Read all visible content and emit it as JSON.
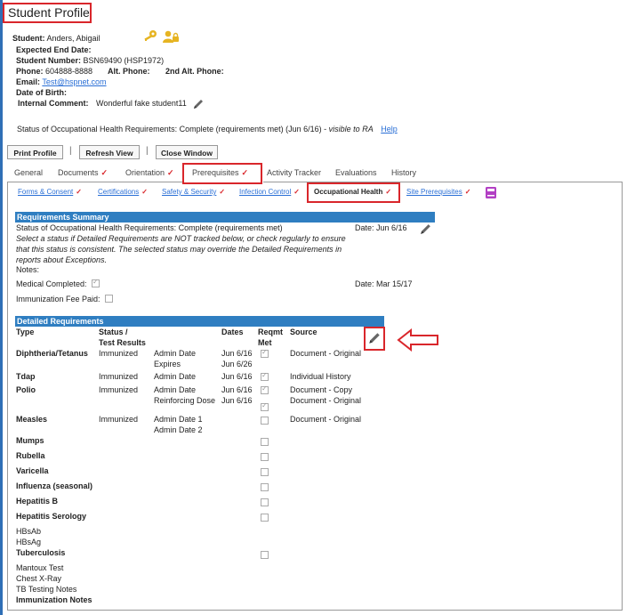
{
  "header": {
    "title": "Student Profile",
    "student_label": "Student:",
    "student_name": "Anders, Abigail",
    "expected_end_date_label": "Expected End Date:",
    "student_number_label": "Student Number:",
    "student_number": "BSN69490  (HSP1972)",
    "phone_label": "Phone:",
    "phone": "604888-8888",
    "alt_phone_label": "Alt. Phone:",
    "alt_phone2_label": "2nd Alt. Phone:",
    "email_label": "Email:",
    "email": "Test@hspnet.com",
    "dob_label": "Date of Birth:",
    "internal_comment_label": "Internal Comment:",
    "internal_comment": "Wonderful fake student11",
    "status_text": "Status of Occupational Health Requirements: Complete (requirements met) (Jun 6/16) - ",
    "status_visible": "visible to RA",
    "help": "Help"
  },
  "toolbar": {
    "print_profile": "Print Profile",
    "refresh_view": "Refresh View",
    "close_window": "Close Window",
    "separator": "|"
  },
  "tabs": [
    {
      "label": "General"
    },
    {
      "label": "Documents"
    },
    {
      "label": "Orientation"
    },
    {
      "label": "Prerequisites"
    },
    {
      "label": "Activity Tracker"
    },
    {
      "label": "Evaluations"
    },
    {
      "label": "History"
    }
  ],
  "check_mark": "✓",
  "subtabs": [
    {
      "label": "Forms & Consent"
    },
    {
      "label": "Certifications"
    },
    {
      "label": "Safety & Security"
    },
    {
      "label": "Infection Control"
    },
    {
      "label": "Occupational Health"
    },
    {
      "label": "Site Prerequisites"
    }
  ],
  "summary": {
    "heading": "Requirements Summary",
    "status": "Status of Occupational Health Requirements: Complete (requirements met)",
    "date": "Date: Jun 6/16",
    "instructions_1": "Select a status if Detailed Requirements are NOT tracked below, or check regularly to ensure",
    "instructions_2": "that this status is consistent. The selected status may override the Detailed Requirements in",
    "instructions_3": "reports about Exceptions.",
    "notes_label": "Notes:",
    "medical_completed_label": "Medical Completed:",
    "medical_completed_date": "Date: Mar 15/17",
    "immunization_fee_label": "Immunization Fee Paid:"
  },
  "detailed": {
    "heading": "Detailed Requirements",
    "columns": {
      "type": "Type",
      "status_1": "Status /",
      "status_2": "Test Results",
      "dates": "Dates",
      "reqmt_1": "Reqmt",
      "reqmt_2": "Met",
      "source": "Source"
    },
    "rows": {
      "diph_type": "Diphtheria/Tetanus",
      "diph_status": "Immunized",
      "diph_label1": "Admin Date",
      "diph_label2": "Expires",
      "diph_date1": "Jun 6/16",
      "diph_date2": "Jun 6/26",
      "diph_source": "Document - Original",
      "tdap_type": "Tdap",
      "tdap_status": "Immunized",
      "tdap_label1": "Admin Date",
      "tdap_date1": "Jun 6/16",
      "tdap_source": "Individual History",
      "polio_type": "Polio",
      "polio_status": "Immunized",
      "polio_label1": "Admin Date",
      "polio_label2": "Reinforcing Dose",
      "polio_date1": "Jun 6/16",
      "polio_date2": "Jun 6/16",
      "polio_source1": "Document - Copy",
      "polio_source2": "Document - Original",
      "measles_type": "Measles",
      "measles_status": "Immunized",
      "measles_label1": "Admin Date 1",
      "measles_label2": "Admin Date 2",
      "measles_source": "Document - Original",
      "mumps": "Mumps",
      "rubella": "Rubella",
      "varicella": "Varicella",
      "influenza": "Influenza (seasonal)",
      "hepb": "Hepatitis B",
      "hepser": "Hepatitis Serology",
      "hbsab": "HBsAb",
      "hbsag": "HBsAg",
      "tb": "Tuberculosis",
      "mantoux": "Mantoux Test",
      "chest": "Chest X-Ray",
      "tbnotes": "TB Testing Notes",
      "immnotes": "Immunization Notes"
    }
  },
  "colors": {
    "accent_red": "#d9262b",
    "section_blue": "#2f7ec1",
    "icon_gold": "#e6b422",
    "book_purple": "#b23fc4"
  }
}
